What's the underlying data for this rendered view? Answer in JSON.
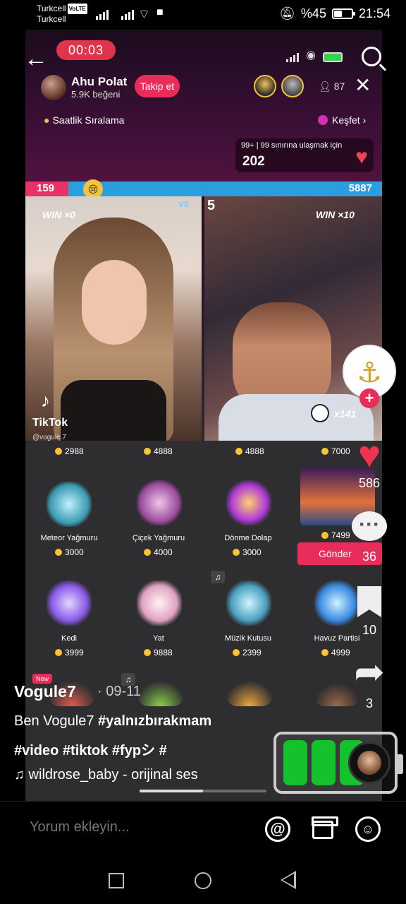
{
  "status_bar": {
    "carrier_1": "Turkcell",
    "volte": "VoLTE",
    "carrier_2": "Turkcell",
    "battery_percent": "%45",
    "time": "21:54"
  },
  "live": {
    "timer": "00:03",
    "host_name": "Ahu Polat",
    "host_likes": "5.9K beğeni",
    "follow_label": "Takip et",
    "viewer_count": "87",
    "ranking_label": "Saatlik Sıralama",
    "explore_label": "Keşfet ›",
    "goal_text": "99+ | 99 sınırına ulaşmak için",
    "goal_count": "202"
  },
  "battle": {
    "score_left": "159",
    "score_right": "5887",
    "left_fraction": 0.12,
    "win_left": "WIN ×0",
    "win_right": "WIN ×10",
    "right_number": "5",
    "vs": "VS",
    "tiktok": "TikTok",
    "tiktok_user": "@vogule.7",
    "multiplier": "x141"
  },
  "gifts": {
    "top_prices": [
      "2988",
      "4888",
      "4888",
      "7000"
    ],
    "row1": [
      {
        "name": "Meteor Yağmuru",
        "price": "3000",
        "color": "#7fd3e3"
      },
      {
        "name": "Çiçek Yağmuru",
        "price": "4000",
        "color": "#d27ac9"
      },
      {
        "name": "Dönme Dolap",
        "price": "3000",
        "color": "#c95ad9"
      },
      {
        "name": "",
        "price": "7499",
        "color": "#e07a3a"
      }
    ],
    "row2": [
      {
        "name": "Kedi",
        "price": "3999",
        "color": "#a57ae8"
      },
      {
        "name": "Yat",
        "price": "9888",
        "color": "#e8b2d0"
      },
      {
        "name": "Müzik Kutusu",
        "price": "2399",
        "color": "#6fc8d8"
      },
      {
        "name": "Havuz Partisi",
        "price": "4999",
        "color": "#58b8e8"
      }
    ],
    "send_label": "Gönder",
    "new_label": "New"
  },
  "rail": {
    "likes": "586",
    "comments": "36",
    "saves": "10",
    "shares": "3"
  },
  "caption": {
    "user": "Vogule7",
    "date": "· 09-11",
    "line1_plain": "Ben Vogule7 ",
    "line1_tag": "#yalnızbırakmam",
    "line2": "#video #tiktok #fypシ #",
    "music": "♫ wildrose_baby - orijinal ses"
  },
  "video_progress": 0.5,
  "comment_bar": {
    "placeholder": "Yorum ekleyin..."
  }
}
